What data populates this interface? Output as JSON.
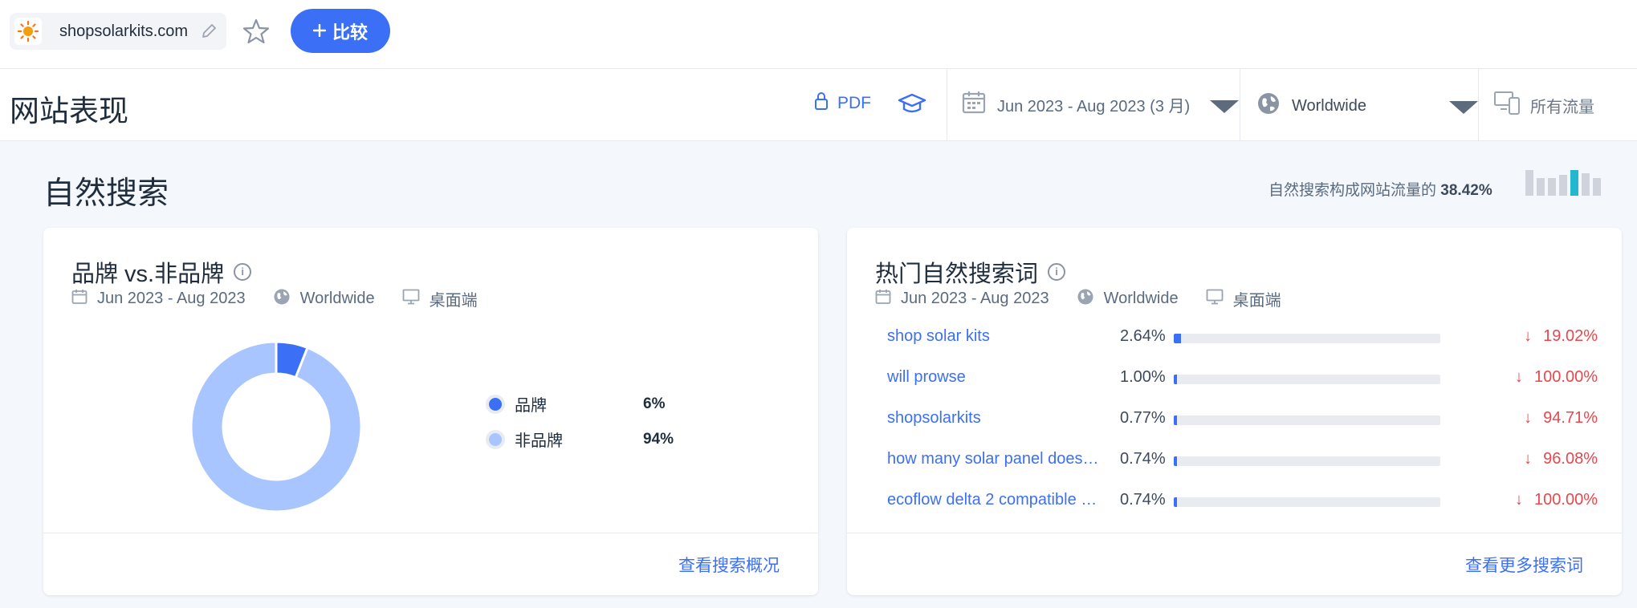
{
  "site": {
    "name": "shopsolarkits.com"
  },
  "topbar": {
    "compare_label": "比较"
  },
  "header": {
    "title": "网站表现",
    "pdf_label": "PDF",
    "date_range": "Jun 2023 - Aug 2023 (3 月)",
    "geo": "Worldwide",
    "traffic": "所有流量"
  },
  "section": {
    "title": "自然搜索",
    "share_prefix": "自然搜索构成网站流量的",
    "share_value": "38.42%"
  },
  "brand_card": {
    "title": "品牌 vs.非品牌",
    "date": "Jun 2023 - Aug 2023",
    "geo": "Worldwide",
    "device": "桌面端",
    "legend": [
      {
        "label": "品牌",
        "value": "6%",
        "color": "#3b6ff6"
      },
      {
        "label": "非品牌",
        "value": "94%",
        "color": "#a8c5ff"
      }
    ],
    "footer_link": "查看搜索概况"
  },
  "keywords_card": {
    "title": "热门自然搜索词",
    "date": "Jun 2023 - Aug 2023",
    "geo": "Worldwide",
    "device": "桌面端",
    "rows": [
      {
        "keyword": "shop solar kits",
        "share": "2.64%",
        "share_fraction": 0.0264,
        "change": "19.02%"
      },
      {
        "keyword": "will prowse",
        "share": "1.00%",
        "share_fraction": 0.01,
        "change": "100.00%"
      },
      {
        "keyword": "shopsolarkits",
        "share": "0.77%",
        "share_fraction": 0.0077,
        "change": "94.71%"
      },
      {
        "keyword": "how many solar panel does…",
        "share": "0.74%",
        "share_fraction": 0.0074,
        "change": "96.08%"
      },
      {
        "keyword": "ecoflow delta 2 compatible …",
        "share": "0.74%",
        "share_fraction": 0.0074,
        "change": "100.00%"
      }
    ],
    "footer_link": "查看更多搜索词"
  },
  "chart_data": {
    "type": "pie",
    "categories": [
      "品牌",
      "非品牌"
    ],
    "values": [
      6,
      94
    ]
  },
  "colors": {
    "accent": "#3b6ff6",
    "light_accent": "#a8c5ff",
    "negative": "#e5484d",
    "highlight_bar": "#22b8cf"
  }
}
